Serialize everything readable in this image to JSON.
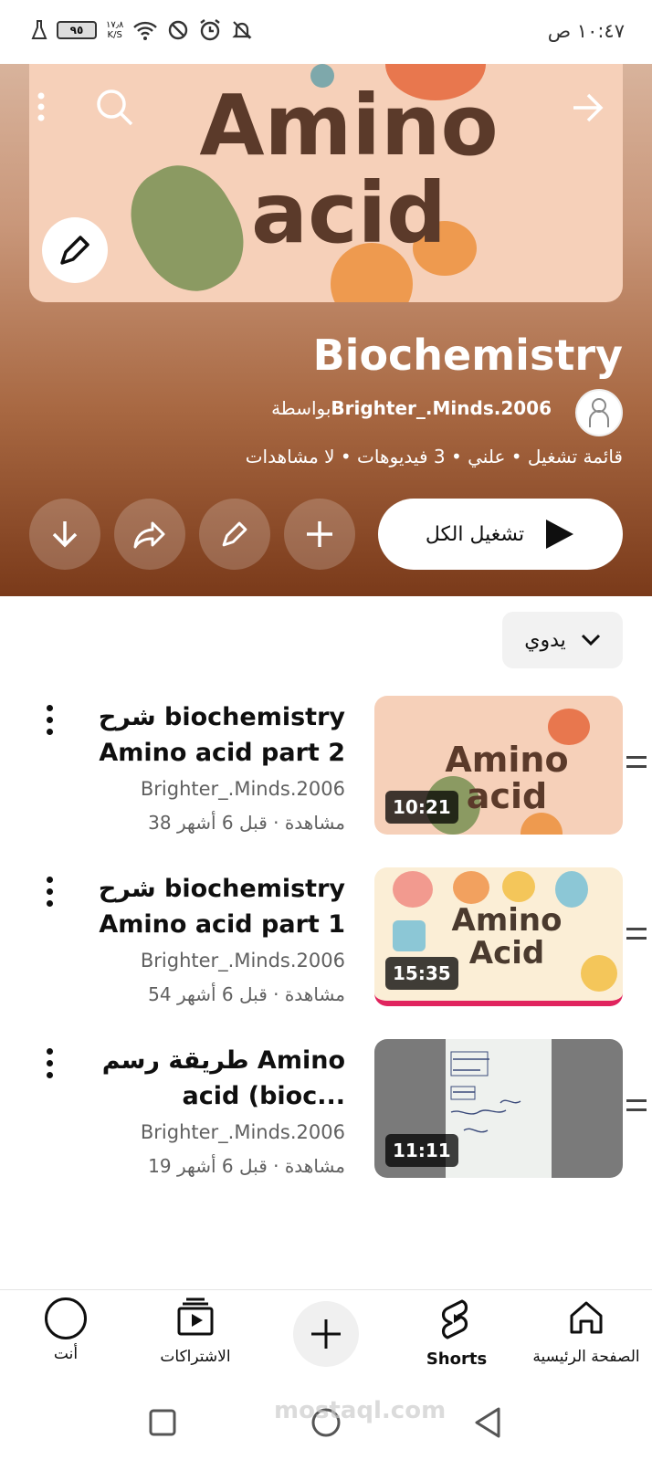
{
  "status_bar": {
    "time": "١٠:٤٧ ص",
    "battery": "٩٥",
    "net_speed": "١٧٫٨",
    "net_unit": "K/S"
  },
  "playlist": {
    "banner_text": "Amino acid",
    "title": "Biochemistry",
    "by_prefix": "بواسطة",
    "owner": "Brighter_.Minds.2006",
    "meta": "قائمة تشغيل • علني • 3 فيديوهات • لا مشاهدات",
    "play_all_label": "تشغيل الكل",
    "sort_label": "يدوي"
  },
  "videos": [
    {
      "title": "شرح biochemistry Amino acid part 2",
      "channel": "Brighter_.Minds.2006",
      "views": "38 مشاهدة · قبل 6 أشهر",
      "duration": "10:21",
      "thumb_text": "Amino acid"
    },
    {
      "title": "شرح biochemistry Amino acid part 1",
      "channel": "Brighter_.Minds.2006",
      "views": "54 مشاهدة · قبل 6 أشهر",
      "duration": "15:35",
      "thumb_text": "Amino Acid"
    },
    {
      "title": "طريقة رسم Amino acid (bioc...",
      "channel": "Brighter_.Minds.2006",
      "views": "19 مشاهدة · قبل 6 أشهر",
      "duration": "11:11",
      "thumb_text": ""
    }
  ],
  "bottom_nav": {
    "home": "الصفحة الرئيسية",
    "shorts": "Shorts",
    "subscriptions": "الاشتراكات",
    "you": "أنت"
  },
  "watermark": "mostaql.com",
  "colors": {
    "accent_red": "#e0245e",
    "hero_brown": "#7a3a1a",
    "banner_peach": "#f6d0b9"
  }
}
